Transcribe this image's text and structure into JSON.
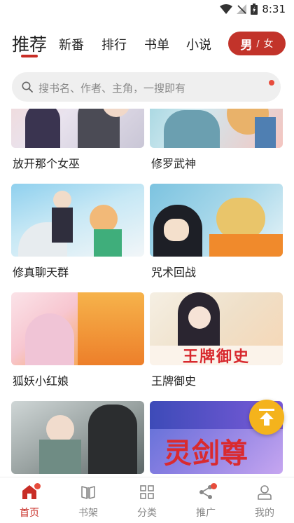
{
  "status": {
    "time": "8:31"
  },
  "tabs": [
    {
      "label": "推荐",
      "active": true
    },
    {
      "label": "新番"
    },
    {
      "label": "排行"
    },
    {
      "label": "书单"
    },
    {
      "label": "小说"
    }
  ],
  "gender": {
    "male": "男",
    "separator": "/",
    "female": "女"
  },
  "search": {
    "placeholder": "搜书名、作者、主角，一搜即有"
  },
  "comics": [
    {
      "title": "放开那个女巫"
    },
    {
      "title": "修罗武神"
    },
    {
      "title": "修真聊天群"
    },
    {
      "title": "咒术回战"
    },
    {
      "title": "狐妖小红娘"
    },
    {
      "title": "王牌御史",
      "cover_text": "王牌御史"
    },
    {
      "title": "",
      "cover_text": ""
    },
    {
      "title": "",
      "cover_text": "灵剑尊"
    }
  ],
  "bottom_nav": [
    {
      "label": "首页",
      "icon": "home-icon",
      "active": true,
      "badge": true
    },
    {
      "label": "书架",
      "icon": "bookshelf-icon"
    },
    {
      "label": "分类",
      "icon": "category-icon"
    },
    {
      "label": "推广",
      "icon": "share-icon",
      "badge": true
    },
    {
      "label": "我的",
      "icon": "profile-icon"
    }
  ],
  "colors": {
    "accent": "#c82d26",
    "fab": "#f4b31c",
    "badge": "#e74c3c"
  }
}
